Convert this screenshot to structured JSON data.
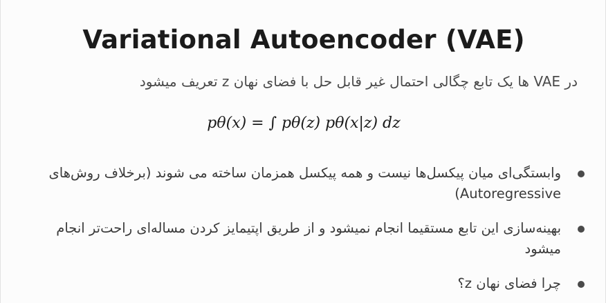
{
  "slide": {
    "title": "Variational Autoencoder (VAE)",
    "intro": "در VAE ها یک تابع چگالی احتمال غیر قابل حل با فضای نهان z تعریف میشود",
    "formula": "pθ(x) = ∫ pθ(z) pθ(x|z) dz",
    "bullets": [
      "وابستگی‌ای میان پیکسل‌ها نیست و همه پیکسل همزمان ساخته می شوند (برخلاف روش‌های Autoregressive)",
      "بهینه‌سازی این تابع مستقیما انجام نمیشود و از طریق اپتیمایز کردن مساله‌ای راحت‌تر انجام میشود",
      "چرا فضای نهان z؟"
    ]
  },
  "colors": {
    "title": "#1b1b1b",
    "body_text": "#3a3a3a",
    "bullet": "#4a4a4a",
    "background": "#fcfcfc"
  }
}
